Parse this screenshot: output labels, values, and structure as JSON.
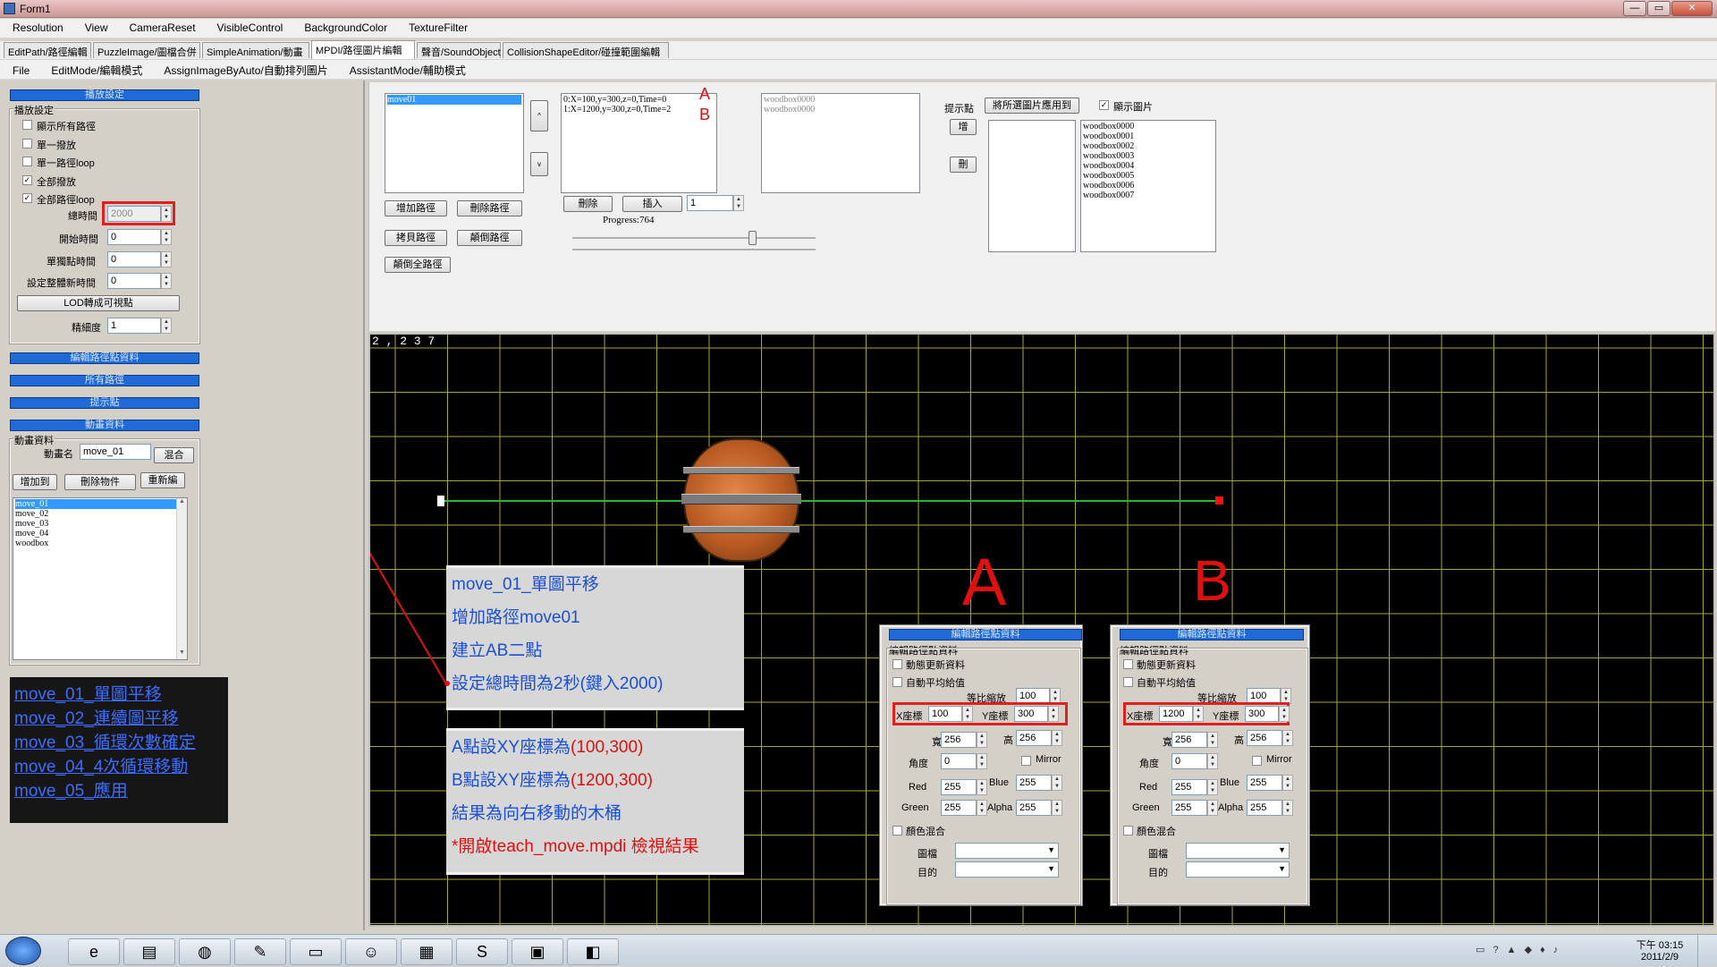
{
  "window": {
    "title": "Form1",
    "min_label": "—",
    "max_label": "▭",
    "close_label": "✕"
  },
  "menu": {
    "items": [
      "Resolution",
      "View",
      "CameraReset",
      "VisibleControl",
      "BackgroundColor",
      "TextureFilter"
    ]
  },
  "tabs": [
    "EditPath/路徑編輯",
    "PuzzleImage/圖檔合併",
    "SimpleAnimation/動畫",
    "MPDI/路徑圖片編輯",
    "聲音/SoundObject",
    "CollisionShapeEditor/碰撞範圍編輯"
  ],
  "submenu": {
    "items": [
      "File",
      "EditMode/編輯模式",
      "AssignImageByAuto/自動排列圖片",
      "AssistantMode/輔助模式"
    ]
  },
  "left": {
    "bar_playback": "播放設定",
    "group_playback": "播放設定",
    "checks": [
      {
        "label": "顯示所有路徑",
        "checked": false
      },
      {
        "label": "單一撥放",
        "checked": false
      },
      {
        "label": "單一路徑loop",
        "checked": false
      },
      {
        "label": "全部撥放",
        "checked": true
      },
      {
        "label": "全部路徑loop",
        "checked": true
      }
    ],
    "total_time_label": "總時間",
    "total_time_value": "2000",
    "start_time_label": "開始時間",
    "start_time_value": "0",
    "single_point_label": "單獨點時間",
    "single_point_value": "0",
    "set_all_label": "設定整體新時間",
    "set_all_value": "0",
    "lod_button": "LOD轉成可視點",
    "precision_label": "精細度",
    "precision_value": "1",
    "bar_edit_points": "編輯路徑點資料",
    "bar_all_paths": "所有路徑",
    "bar_hint": "提示點",
    "bar_anim": "動畫資料",
    "group_anim": "動畫資料",
    "anim_name_label": "動畫名",
    "anim_name_value": "move_01",
    "mix_button": "混合",
    "add_button": "增加到",
    "del_button": "刪除物件",
    "rename_button": "重新編",
    "anim_list": [
      "move_01",
      "move_02",
      "move_03",
      "move_04",
      "woodbox"
    ]
  },
  "legend": [
    "move_01_單圖平移",
    "move_02_連續圖平移",
    "move_03_循環次數確定",
    "move_04_4次循環移動",
    "move_05_應用"
  ],
  "top": {
    "path_list": [
      "move01"
    ],
    "up_label": "^",
    "down_label": "v",
    "add_path": "增加路徑",
    "del_path": "刪除路徑",
    "copy_path": "拷貝路徑",
    "reverse": "顛倒路徑",
    "reverse_all": "顛倒全路徑",
    "points": [
      "0:X=100,y=300,z=0,Time=0",
      "1:X=1200,y=300,z=0,Time=2"
    ],
    "point_a": "A",
    "point_b": "B",
    "delete": "刪除",
    "insert": "插入",
    "insert_value": "1",
    "progress_label": "Progress:764",
    "progress_fraction": 0.74,
    "image_list": [
      "woodbox0000",
      "woodbox0000"
    ],
    "hint_label": "提示點",
    "apply_btn": "將所選圖片應用到",
    "show_image": "顯示圖片",
    "show_checked": true,
    "add_btn": "增",
    "del_btn": "刪",
    "all_images": [
      "woodbox0000",
      "woodbox0001",
      "woodbox0002",
      "woodbox0003",
      "woodbox0004",
      "woodbox0005",
      "woodbox0006",
      "woodbox0007"
    ]
  },
  "canvas": {
    "coord": "2 , 2 3 7",
    "note1": [
      "move_01_單圖平移",
      "增加路徑move01",
      "建立AB二點",
      "設定總時間為2秒(鍵入2000)"
    ],
    "note2": [
      {
        "parts": [
          [
            "A點設XY座標為",
            false
          ],
          [
            "(100,300)",
            true
          ]
        ]
      },
      {
        "parts": [
          [
            "B點設XY座標為",
            false
          ],
          [
            "(1200,300)",
            true
          ]
        ]
      },
      {
        "parts": [
          [
            "結果為向右移動的木桶",
            false
          ]
        ]
      },
      {
        "parts": [
          [
            "*開啟teach_move.mpdi 檢視結果",
            true
          ]
        ]
      }
    ],
    "big_a": "A",
    "big_b": "B"
  },
  "panels": [
    {
      "id": "a",
      "title": "編輯路徑點資料",
      "group": "編輯路徑點資料",
      "dyn": "動態更新資料",
      "avg": "自動平均給值",
      "scale_label": "等比縮放",
      "scale": "100",
      "x_label": "X座標",
      "x": "100",
      "y_label": "Y座標",
      "y": "300",
      "w_label": "寬",
      "w": "256",
      "h_label": "高",
      "h": "256",
      "angle_label": "角度",
      "angle": "0",
      "mirror": "Mirror",
      "red_label": "Red",
      "red": "255",
      "blue_label": "Blue",
      "blue": "255",
      "green_label": "Green",
      "green": "255",
      "alpha_label": "Alpha",
      "alpha": "255",
      "blend": "顏色混合",
      "img_label": "圖檔",
      "dst_label": "目的"
    },
    {
      "id": "b",
      "title": "編輯路徑點資料",
      "group": "編輯路徑點資料",
      "dyn": "動態更新資料",
      "avg": "自動平均給值",
      "scale_label": "等比縮放",
      "scale": "100",
      "x_label": "X座標",
      "x": "1200",
      "y_label": "Y座標",
      "y": "300",
      "w_label": "寬",
      "w": "256",
      "h_label": "高",
      "h": "256",
      "angle_label": "角度",
      "angle": "0",
      "mirror": "Mirror",
      "red_label": "Red",
      "red": "255",
      "blue_label": "Blue",
      "blue": "255",
      "green_label": "Green",
      "green": "255",
      "alpha_label": "Alpha",
      "alpha": "255",
      "blend": "顏色混合",
      "img_label": "圖檔",
      "dst_label": "目的"
    }
  ],
  "taskbar": {
    "time": "下午 03:15",
    "date": "2011/2/9"
  }
}
